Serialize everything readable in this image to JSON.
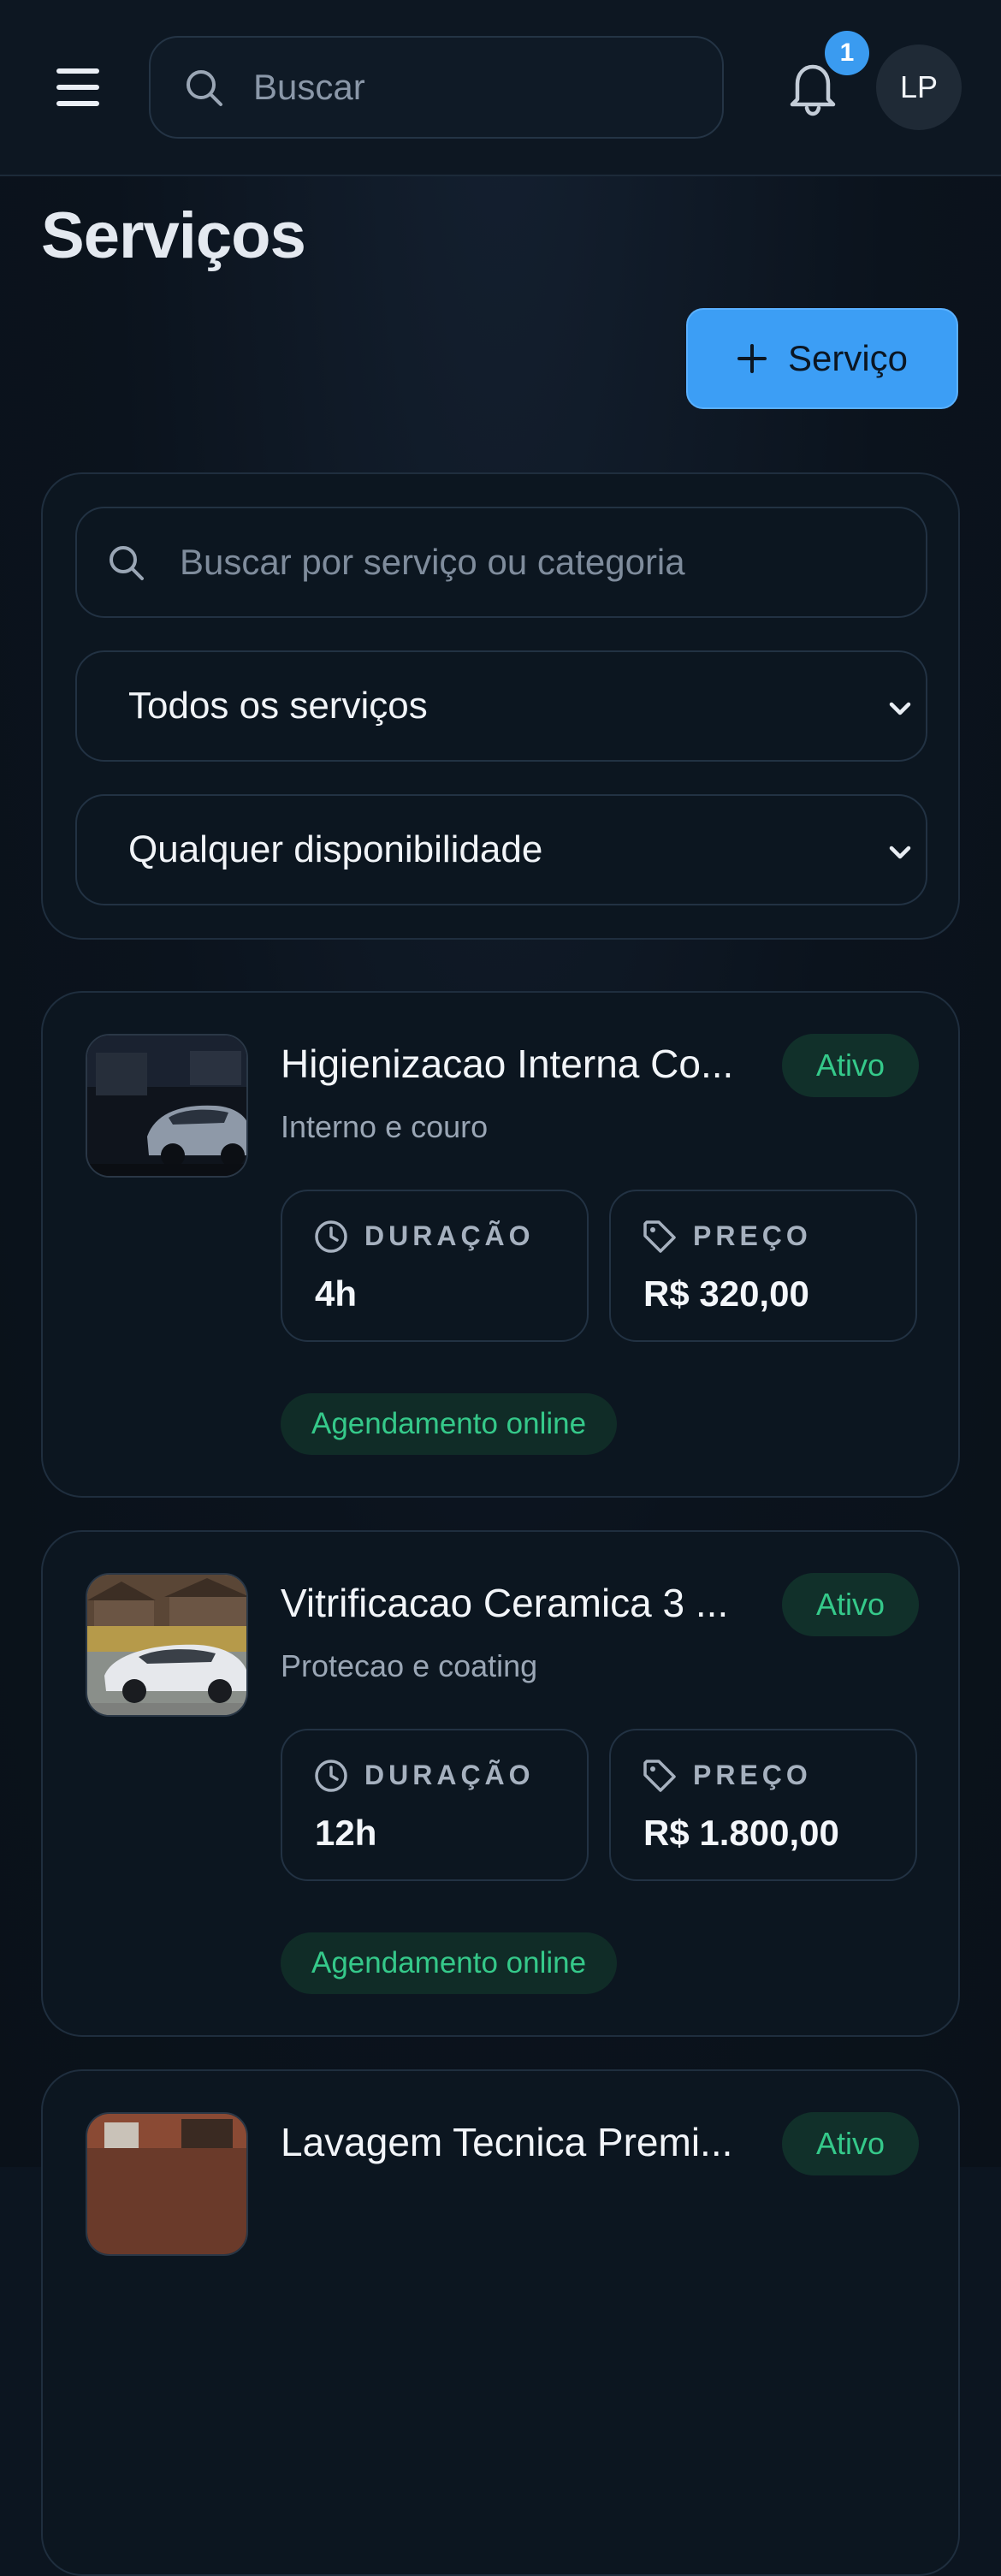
{
  "header": {
    "search_placeholder": "Buscar",
    "notification_count": "1",
    "avatar_initials": "LP"
  },
  "page": {
    "title": "Serviços",
    "add_button_label": "Serviço"
  },
  "filters": {
    "search_placeholder": "Buscar por serviço ou categoria",
    "type_select": "Todos os serviços",
    "availability_select": "Qualquer disponibilidade"
  },
  "labels": {
    "duration": "DURAÇÃO",
    "price": "PREÇO"
  },
  "services": [
    {
      "title": "Higienizacao Interna Co...",
      "category": "Interno e couro",
      "status": "Ativo",
      "duration": "4h",
      "price": "R$ 320,00",
      "tag": "Agendamento online"
    },
    {
      "title": "Vitrificacao Ceramica 3 ...",
      "category": "Protecao e coating",
      "status": "Ativo",
      "duration": "12h",
      "price": "R$ 1.800,00",
      "tag": "Agendamento online"
    },
    {
      "title": "Lavagem Tecnica Premi...",
      "status": "Ativo"
    }
  ],
  "colors": {
    "accent": "#3c9ef5",
    "status_green": "#35c98a",
    "background": "#0c1620"
  },
  "icons": [
    "menu-icon",
    "search-icon",
    "bell-icon",
    "plus-icon",
    "chevron-down-icon",
    "clock-icon",
    "tag-icon"
  ]
}
